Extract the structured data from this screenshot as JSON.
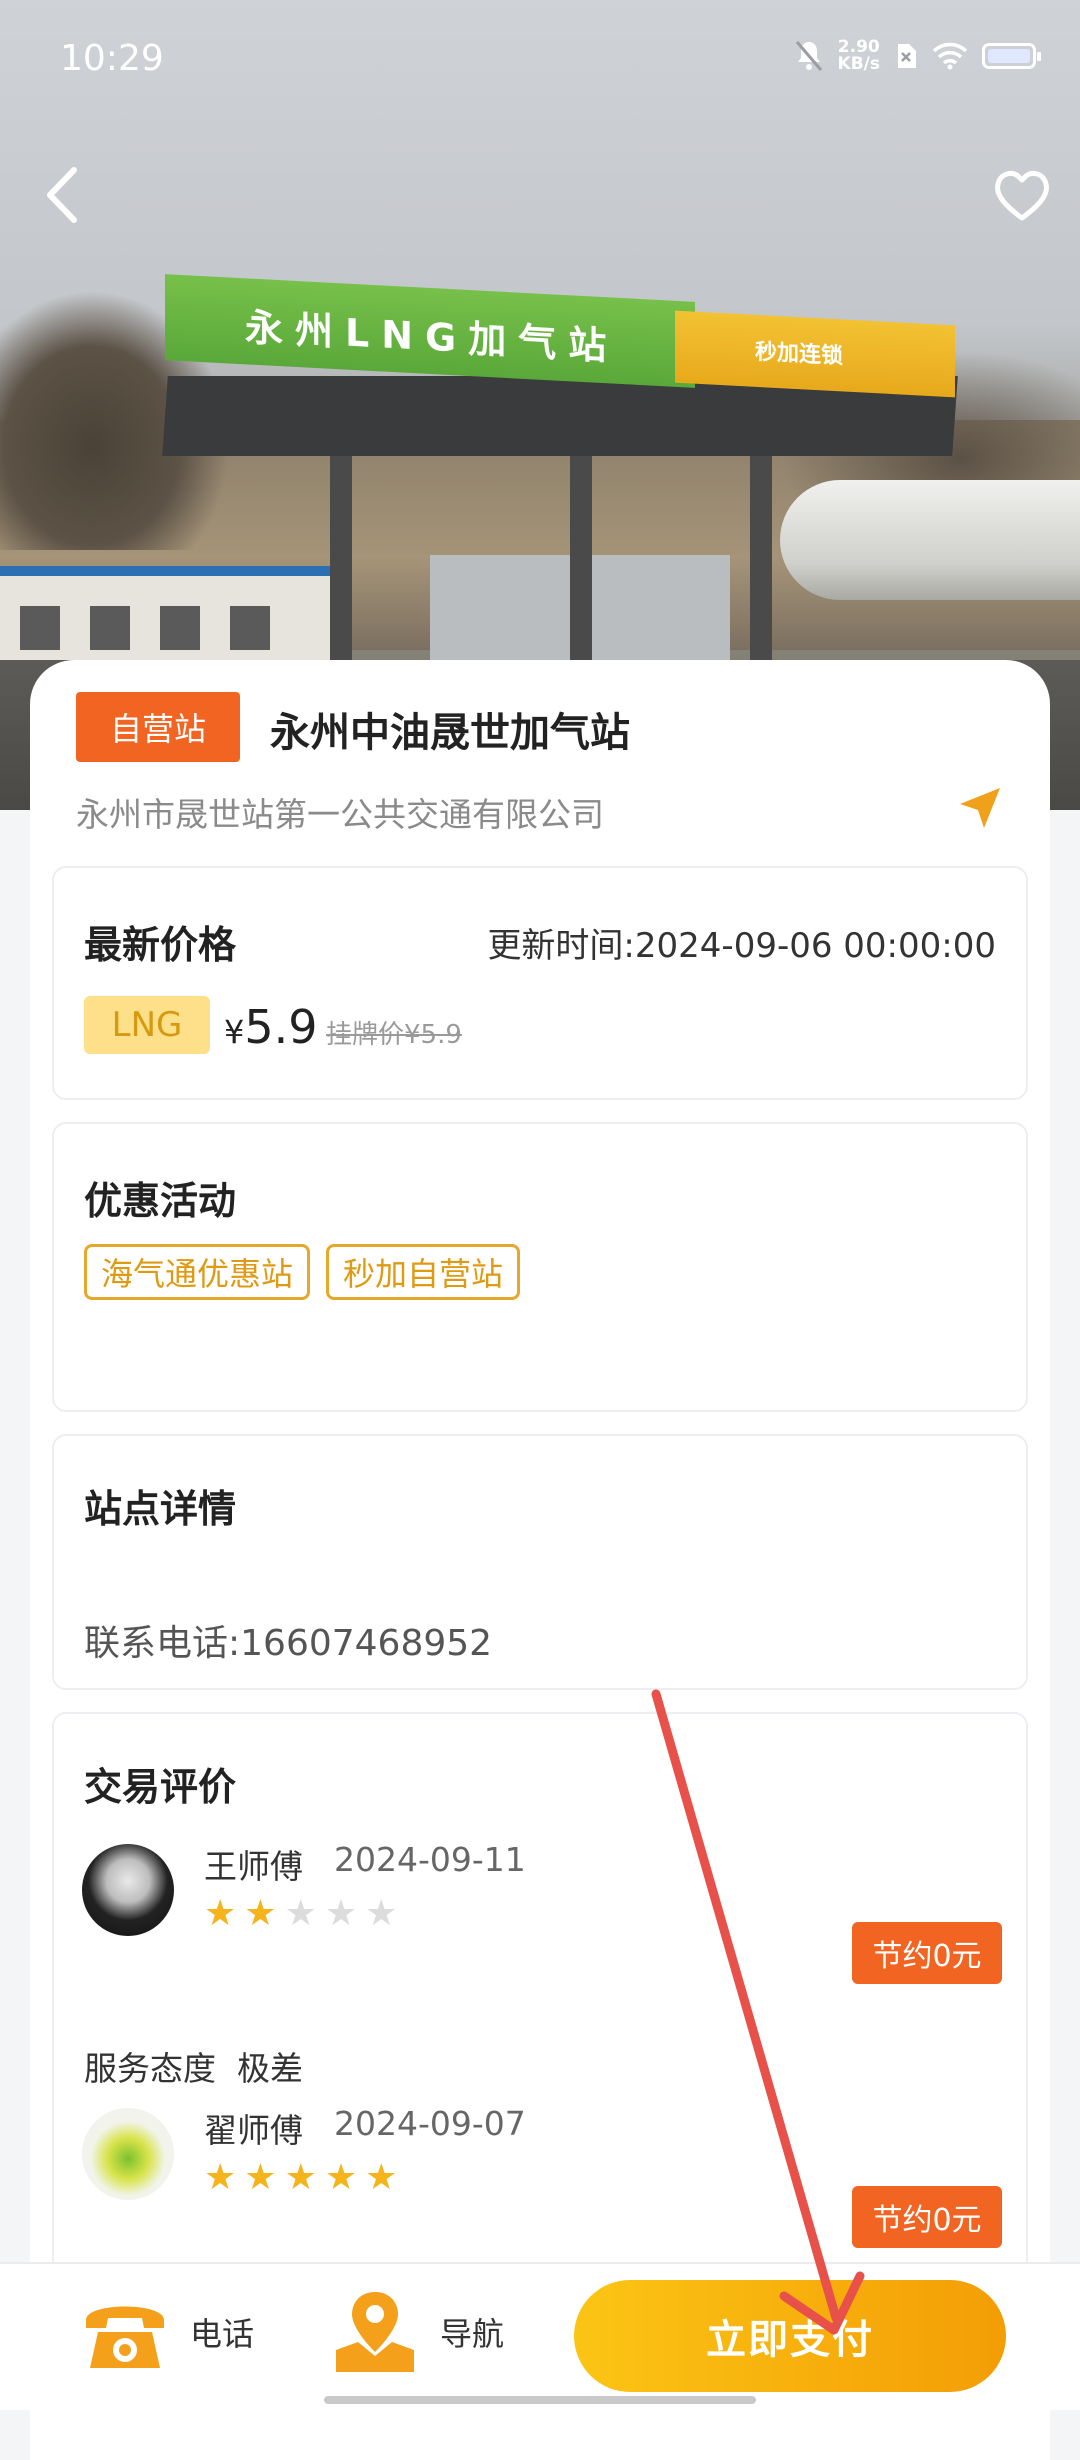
{
  "status_bar": {
    "time": "10:29",
    "net_speed_value": "2.90",
    "net_speed_unit": "KB/s"
  },
  "hero": {
    "sign_text": "永州LNG加气站",
    "sign_brand": "秒加连锁"
  },
  "station": {
    "badge": "自营站",
    "name": "永州中油晟世加气站",
    "company": "永州市晟世站第一公共交通有限公司"
  },
  "price": {
    "title": "最新价格",
    "update_time": "更新时间:2024-09-06 00:00:00",
    "fuel": "LNG",
    "currency": "¥",
    "current": "5.9",
    "list_price": "挂牌价¥5.9"
  },
  "promo": {
    "title": "优惠活动",
    "tags": [
      "海气通优惠站",
      "秒加自营站"
    ]
  },
  "detail": {
    "title": "站点详情",
    "phone": "联系电话:16607468952"
  },
  "reviews": {
    "title": "交易评价",
    "items": [
      {
        "name": "王师傅",
        "date": "2024-09-11",
        "rating": 2,
        "max_rating": 5,
        "badge": "节约0元",
        "comment": "服务态度  极差"
      },
      {
        "name": "翟师傅",
        "date": "2024-09-07",
        "rating": 5,
        "max_rating": 5,
        "badge": "节约0元"
      }
    ]
  },
  "bottom_bar": {
    "phone": "电话",
    "navigate": "导航",
    "pay": "立即支付"
  },
  "colors": {
    "accent_orange": "#f26422",
    "pay_gradient_start": "#fbc514",
    "pay_gradient_end": "#f49d06",
    "star": "#f5b41b",
    "annotation_arrow": "#e8504a"
  }
}
